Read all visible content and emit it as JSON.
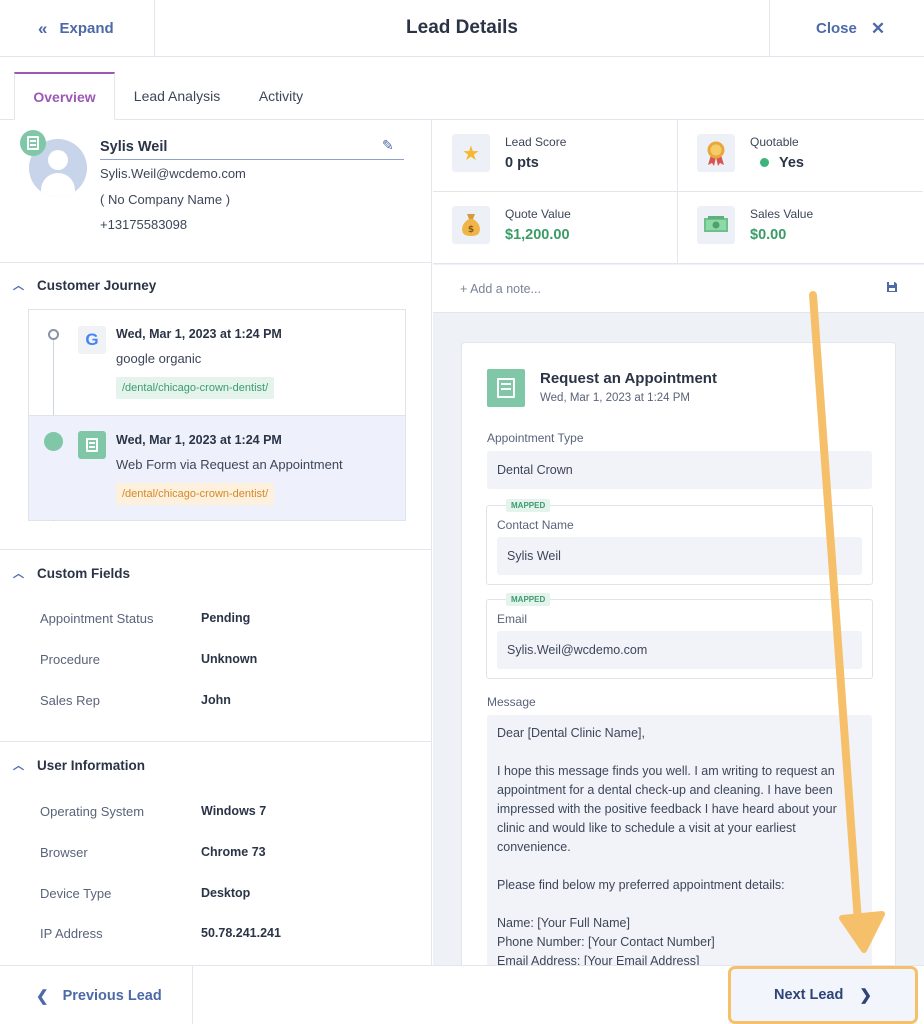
{
  "header": {
    "expand_label": "Expand",
    "title": "Lead Details",
    "close_label": "Close"
  },
  "tabs": [
    {
      "label": "Overview",
      "active": true
    },
    {
      "label": "Lead Analysis",
      "active": false
    },
    {
      "label": "Activity",
      "active": false
    }
  ],
  "profile": {
    "name": "Sylis Weil",
    "email": "Sylis.Weil@wcdemo.com",
    "company": "( No Company Name )",
    "phone": "+13175583098"
  },
  "customer_journey": {
    "title": "Customer Journey",
    "items": [
      {
        "icon": "google-icon",
        "date": "Wed, Mar 1, 2023 at 1:24 PM",
        "source": "google organic",
        "path": "/dental/chicago-crown-dentist/"
      },
      {
        "icon": "form-icon",
        "date": "Wed, Mar 1, 2023 at 1:24 PM",
        "source": "Web Form via Request an Appointment",
        "path": "/dental/chicago-crown-dentist/"
      }
    ]
  },
  "custom_fields": {
    "title": "Custom Fields",
    "rows": [
      {
        "label": "Appointment Status",
        "value": "Pending"
      },
      {
        "label": "Procedure",
        "value": "Unknown"
      },
      {
        "label": "Sales Rep",
        "value": "John"
      }
    ]
  },
  "user_information": {
    "title": "User Information",
    "rows": [
      {
        "label": "Operating System",
        "value": "Windows 7"
      },
      {
        "label": "Browser",
        "value": "Chrome 73"
      },
      {
        "label": "Device Type",
        "value": "Desktop"
      },
      {
        "label": "IP Address",
        "value": "50.78.241.241"
      }
    ]
  },
  "stats": {
    "lead_score": {
      "label": "Lead Score",
      "value": "0 pts",
      "icon": "star-icon"
    },
    "quotable": {
      "label": "Quotable",
      "value": "Yes",
      "icon": "award-icon"
    },
    "quote_value": {
      "label": "Quote Value",
      "value": "$1,200.00",
      "icon": "money-bag-icon"
    },
    "sales_value": {
      "label": "Sales Value",
      "value": "$0.00",
      "icon": "cash-icon"
    }
  },
  "note": {
    "placeholder": "+ Add a note..."
  },
  "form_card": {
    "title": "Request an Appointment",
    "date": "Wed, Mar 1, 2023 at 1:24 PM",
    "appointment_type_label": "Appointment Type",
    "appointment_type_value": "Dental Crown",
    "mapped_tag": "MAPPED",
    "contact_name_label": "Contact Name",
    "contact_name_value": "Sylis Weil",
    "email_label": "Email",
    "email_value": "Sylis.Weil@wcdemo.com",
    "message_label": "Message",
    "message": {
      "greeting": "Dear [Dental Clinic Name],",
      "para1": "I hope this message finds you well. I am writing to request an appointment for a dental check-up and cleaning. I have been impressed with the positive feedback I have heard about your clinic and would like to schedule a visit at your earliest convenience.",
      "para2": "Please find below my preferred appointment details:",
      "line_name": "Name: [Your Full Name]",
      "line_phone": "Phone Number: [Your Contact Number]",
      "line_email": "Email Address: [Your Email Address]"
    }
  },
  "footer": {
    "prev_label": "Previous Lead",
    "next_label": "Next Lead"
  },
  "colors": {
    "accent": "#4d6aa8",
    "tab_active": "#9b59b6",
    "green": "#3a9b67",
    "highlight": "#f6c06b"
  }
}
